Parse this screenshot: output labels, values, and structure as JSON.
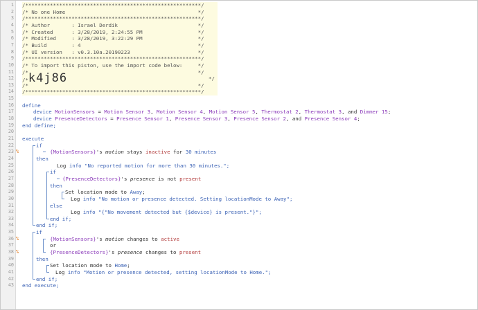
{
  "editor": {
    "line_numbers": [
      "1",
      "2",
      "3",
      "4",
      "5",
      "6",
      "7",
      "8",
      "9",
      "10",
      "11",
      "12",
      "13",
      "14",
      "15",
      "16",
      "17",
      "18",
      "19",
      "20",
      "21",
      "22",
      "23",
      "24",
      "25",
      "26",
      "27",
      "28",
      "29",
      "30",
      "31",
      "32",
      "33",
      "34",
      "35",
      "36",
      "37",
      "38",
      "39",
      "40",
      "41",
      "42",
      "43"
    ],
    "markers": {
      "23": "%",
      "36": "%",
      "38": "%"
    },
    "header": {
      "l1": "/*********************************************************/",
      "l2": "/* No one Home                                           */",
      "l3": "/*********************************************************/",
      "l4": "/* Author       : Israel Derdik                          */",
      "l5": "/* Created      : 3/28/2019, 2:24:55 PM                  */",
      "l6": "/* Modified     : 3/28/2019, 3:22:29 PM                  */",
      "l7": "/* Build        : 4                                      */",
      "l8": "/* UI version   : v0.3.10a.20190223                      */",
      "l9": "/*********************************************************/",
      "l10": "/* To import this piston, use the import code below:     */",
      "l11": "/*                                                       */",
      "l12a": "/*",
      "l12_code": "k4j86",
      "l12b": "*/",
      "l13": "/*                                                       */",
      "l14": "/*********************************************************/"
    },
    "code": {
      "define": "define",
      "device": "device",
      "motion_var": "MotionSensors",
      "eq": " = ",
      "motion_devices": [
        "Motion Sensor 3",
        "Motion Sensor 4",
        "Motion Sensor 5",
        "Thermostat 2",
        "Thermostat 3"
      ],
      "and": ", and ",
      "dimmer": "Dimmer 15",
      "comma": ", ",
      "semi": ";",
      "presence_var": "PresenceDetectors",
      "presence_devices": [
        "Presence Sensor 1",
        "Presence Sensor 3",
        "Presence Sensor 2"
      ],
      "presence_last": "Presence Sensor 4",
      "end_define": "end define;",
      "execute": "execute",
      "if": "if",
      "then": "then",
      "else": "else",
      "end_if": "end if;",
      "or": "or",
      "end_execute": "end execute;",
      "motion_ref": "{MotionSensors}",
      "presence_ref": "{PresenceDetectors}",
      "s": "'s ",
      "motion": "motion",
      "presence": "presence",
      "stays": " stays ",
      "inactive": "inactive",
      "for": " for ",
      "minutes": "30 minutes",
      "log": "Log ",
      "info": "info",
      "log1": "\"No reported motion for more than 30 minutes.\";",
      "is_not": " is not ",
      "present": "present",
      "set_mode": "Set location mode to ",
      "away": "Away",
      "log2": "\"No motion or presence detected. Setting locationMode to Away\";",
      "log3": "\"{\"No movement detected but {$device} is present.\"}\";",
      "changes_to": " changes to ",
      "active": "active",
      "home": "Home",
      "log4": "\"Motion or presence detected, setting locationMode to Home.\";"
    }
  }
}
